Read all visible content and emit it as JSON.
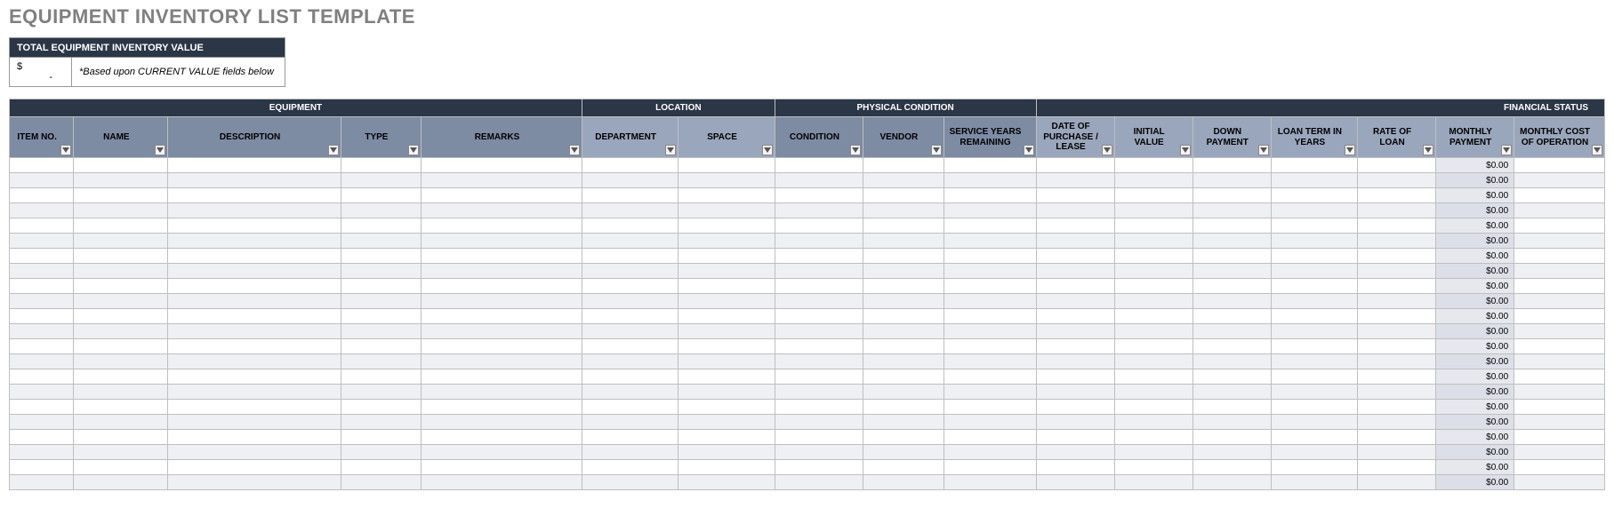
{
  "title": "EQUIPMENT INVENTORY LIST TEMPLATE",
  "totalBox": {
    "header": "TOTAL EQUIPMENT INVENTORY VALUE",
    "currency": "$",
    "value": "-",
    "note": "*Based upon CURRENT VALUE fields below"
  },
  "groups": {
    "equipment": "EQUIPMENT",
    "location": "LOCATION",
    "physical": "PHYSICAL CONDITION",
    "financial": "FINANCIAL STATUS"
  },
  "columns": {
    "itemNo": "ITEM NO.",
    "name": "NAME",
    "description": "DESCRIPTION",
    "type": "TYPE",
    "remarks": "REMARKS",
    "department": "DEPARTMENT",
    "space": "SPACE",
    "condition": "CONDITION",
    "vendor": "VENDOR",
    "serviceYears": "SERVICE YEARS REMAINING",
    "datePurchase": "DATE OF PURCHASE / LEASE",
    "initialValue": "INITIAL VALUE",
    "downPayment": "DOWN PAYMENT",
    "loanTerm": "LOAN TERM IN YEARS",
    "rateLoan": "RATE OF LOAN",
    "monthlyPayment": "MONTHLY PAYMENT",
    "monthlyCost": "MONTHLY COST OF OPERATION"
  },
  "rows": [
    {
      "monthlyPayment": "$0.00"
    },
    {
      "monthlyPayment": "$0.00"
    },
    {
      "monthlyPayment": "$0.00"
    },
    {
      "monthlyPayment": "$0.00"
    },
    {
      "monthlyPayment": "$0.00"
    },
    {
      "monthlyPayment": "$0.00"
    },
    {
      "monthlyPayment": "$0.00"
    },
    {
      "monthlyPayment": "$0.00"
    },
    {
      "monthlyPayment": "$0.00"
    },
    {
      "monthlyPayment": "$0.00"
    },
    {
      "monthlyPayment": "$0.00"
    },
    {
      "monthlyPayment": "$0.00"
    },
    {
      "monthlyPayment": "$0.00"
    },
    {
      "monthlyPayment": "$0.00"
    },
    {
      "monthlyPayment": "$0.00"
    },
    {
      "monthlyPayment": "$0.00"
    },
    {
      "monthlyPayment": "$0.00"
    },
    {
      "monthlyPayment": "$0.00"
    },
    {
      "monthlyPayment": "$0.00"
    },
    {
      "monthlyPayment": "$0.00"
    },
    {
      "monthlyPayment": "$0.00"
    },
    {
      "monthlyPayment": "$0.00"
    }
  ]
}
